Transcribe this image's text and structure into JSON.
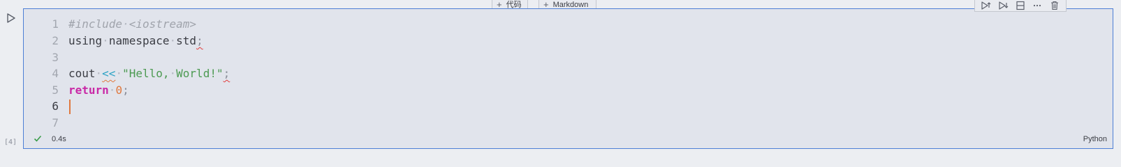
{
  "notebook": {
    "add_code_label": "代码",
    "add_markdown_label": "Markdown"
  },
  "cell": {
    "execution_count": "[4]",
    "status_time": "0.4s",
    "language": "Python",
    "lines": [
      {
        "number": "1",
        "text": "#include <iostream>"
      },
      {
        "number": "2",
        "text": "using namespace std;"
      },
      {
        "number": "3",
        "text": ""
      },
      {
        "number": "4",
        "text": "cout << \"Hello, World!\";"
      },
      {
        "number": "5",
        "text": "return 0;"
      },
      {
        "number": "6",
        "text": ""
      },
      {
        "number": "7",
        "text": ""
      }
    ]
  },
  "toolbar": {
    "icons": [
      "run-above-icon",
      "run-below-icon",
      "split-cell-icon",
      "more-icon",
      "delete-icon"
    ]
  },
  "colors": {
    "cell_border": "#4d7fd6",
    "success": "#3a9d4a",
    "keyword": "#c928a6",
    "string": "#4c9a52",
    "number": "#e0783e",
    "error_squiggle": "#e23b3b"
  }
}
